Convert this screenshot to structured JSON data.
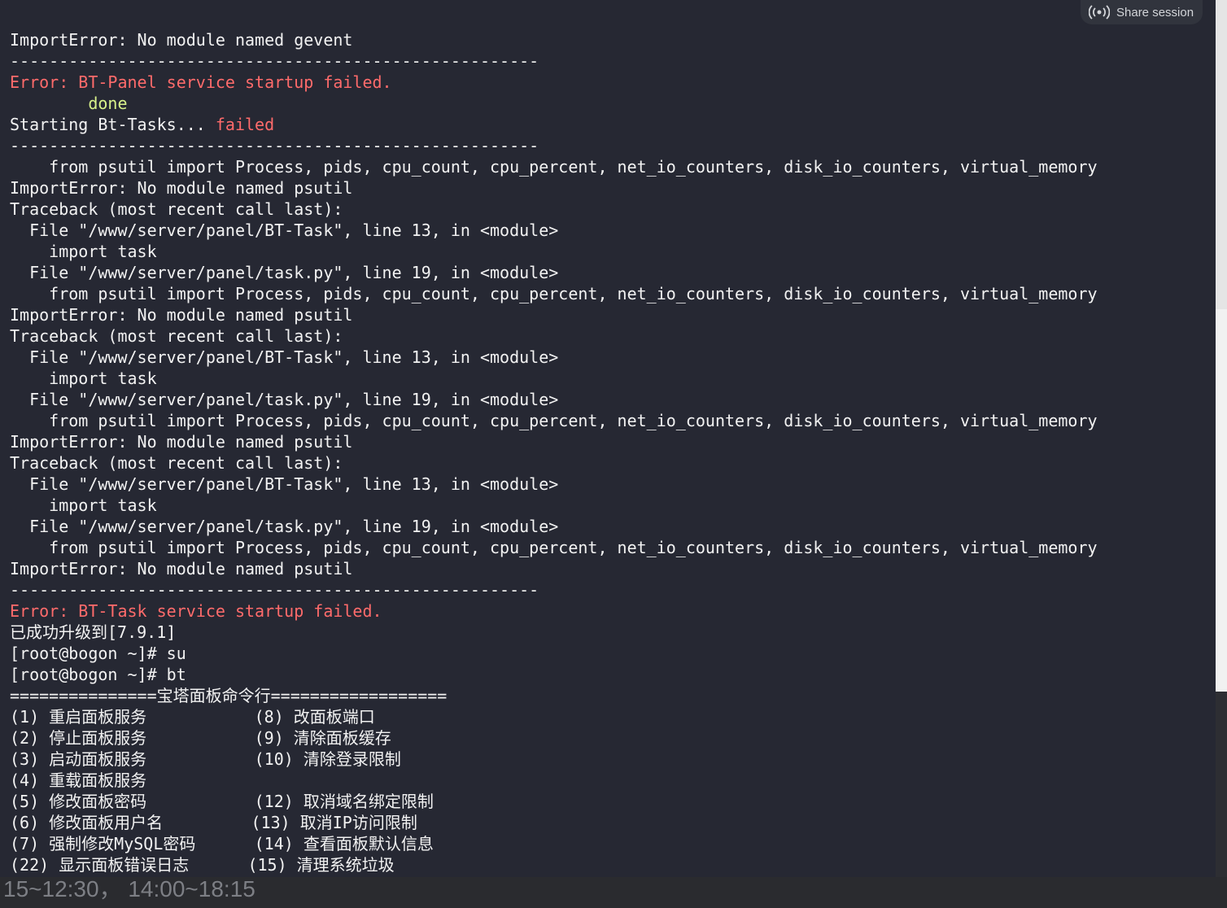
{
  "share": {
    "label": "Share session",
    "icon": "broadcast-icon"
  },
  "terminal": {
    "lines": [
      {
        "text": "ImportError: No module named gevent",
        "color": "default"
      },
      {
        "text": "------------------------------------------------------",
        "color": "default"
      },
      {
        "text": "Error: BT-Panel service startup failed.",
        "color": "red"
      },
      {
        "text": "        done",
        "color": "green"
      },
      {
        "segments": [
          {
            "text": "Starting Bt-Tasks... ",
            "color": "default"
          },
          {
            "text": "failed",
            "color": "red"
          }
        ]
      },
      {
        "text": "------------------------------------------------------",
        "color": "default"
      },
      {
        "text": "    from psutil import Process, pids, cpu_count, cpu_percent, net_io_counters, disk_io_counters, virtual_memory",
        "color": "default"
      },
      {
        "text": "ImportError: No module named psutil",
        "color": "default"
      },
      {
        "text": "Traceback (most recent call last):",
        "color": "default"
      },
      {
        "text": "  File \"/www/server/panel/BT-Task\", line 13, in <module>",
        "color": "default"
      },
      {
        "text": "    import task",
        "color": "default"
      },
      {
        "text": "  File \"/www/server/panel/task.py\", line 19, in <module>",
        "color": "default"
      },
      {
        "text": "    from psutil import Process, pids, cpu_count, cpu_percent, net_io_counters, disk_io_counters, virtual_memory",
        "color": "default"
      },
      {
        "text": "ImportError: No module named psutil",
        "color": "default"
      },
      {
        "text": "Traceback (most recent call last):",
        "color": "default"
      },
      {
        "text": "  File \"/www/server/panel/BT-Task\", line 13, in <module>",
        "color": "default"
      },
      {
        "text": "    import task",
        "color": "default"
      },
      {
        "text": "  File \"/www/server/panel/task.py\", line 19, in <module>",
        "color": "default"
      },
      {
        "text": "    from psutil import Process, pids, cpu_count, cpu_percent, net_io_counters, disk_io_counters, virtual_memory",
        "color": "default"
      },
      {
        "text": "ImportError: No module named psutil",
        "color": "default"
      },
      {
        "text": "Traceback (most recent call last):",
        "color": "default"
      },
      {
        "text": "  File \"/www/server/panel/BT-Task\", line 13, in <module>",
        "color": "default"
      },
      {
        "text": "    import task",
        "color": "default"
      },
      {
        "text": "  File \"/www/server/panel/task.py\", line 19, in <module>",
        "color": "default"
      },
      {
        "text": "    from psutil import Process, pids, cpu_count, cpu_percent, net_io_counters, disk_io_counters, virtual_memory",
        "color": "default"
      },
      {
        "text": "ImportError: No module named psutil",
        "color": "default"
      },
      {
        "text": "------------------------------------------------------",
        "color": "default"
      },
      {
        "text": "Error: BT-Task service startup failed.",
        "color": "red"
      },
      {
        "text": "已成功升级到[7.9.1]",
        "color": "default"
      },
      {
        "text": "[root@bogon ~]# su",
        "color": "default"
      },
      {
        "text": "[root@bogon ~]# bt",
        "color": "default"
      },
      {
        "text": "===============宝塔面板命令行==================",
        "color": "default"
      },
      {
        "text": "(1) 重启面板服务           (8) 改面板端口",
        "color": "default"
      },
      {
        "text": "(2) 停止面板服务           (9) 清除面板缓存",
        "color": "default"
      },
      {
        "text": "(3) 启动面板服务           (10) 清除登录限制",
        "color": "default"
      },
      {
        "text": "(4) 重载面板服务",
        "color": "default"
      },
      {
        "text": "(5) 修改面板密码           (12) 取消域名绑定限制",
        "color": "default"
      },
      {
        "text": "(6) 修改面板用户名         (13) 取消IP访问限制",
        "color": "default"
      },
      {
        "text": "(7) 强制修改MySQL密码      (14) 查看面板默认信息",
        "color": "default"
      },
      {
        "text": "(22) 显示面板错误日志      (15) 清理系统垃圾",
        "color": "default"
      }
    ]
  },
  "background": {
    "partial_text": "15~12:30， 14:00~18:15"
  },
  "colors": {
    "terminal_bg": "#262833",
    "error": "#ff6b6b",
    "success": "#d7f08a",
    "text": "#f2f2f2"
  }
}
